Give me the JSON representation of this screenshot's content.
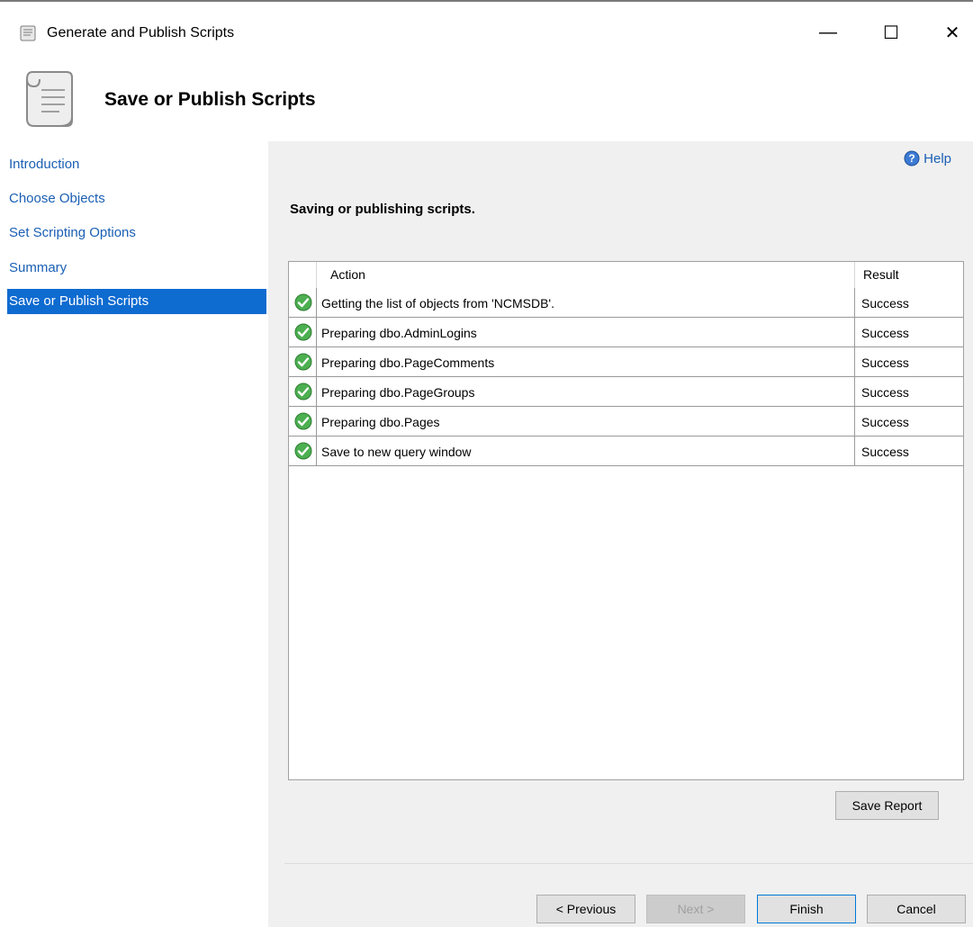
{
  "window": {
    "title": "Generate and Publish Scripts",
    "controls": {
      "minimize": "—",
      "maximize": "☐",
      "close": "✕"
    }
  },
  "header": {
    "title": "Save or Publish Scripts",
    "icon": "script-scroll-icon"
  },
  "sidebar": {
    "items": [
      {
        "label": "Introduction",
        "active": false
      },
      {
        "label": "Choose Objects",
        "active": false
      },
      {
        "label": "Set Scripting Options",
        "active": false
      },
      {
        "label": "Summary",
        "active": false
      },
      {
        "label": "Save or Publish Scripts",
        "active": true
      }
    ]
  },
  "main": {
    "help_label": "Help",
    "status_heading": "Saving or publishing scripts.",
    "grid": {
      "columns": [
        "Action",
        "Result"
      ],
      "rows": [
        {
          "action": "Getting the list of objects from 'NCMSDB'.",
          "result": "Success",
          "status_icon": "success-check-icon"
        },
        {
          "action": "Preparing dbo.AdminLogins",
          "result": "Success",
          "status_icon": "success-check-icon"
        },
        {
          "action": "Preparing dbo.PageComments",
          "result": "Success",
          "status_icon": "success-check-icon"
        },
        {
          "action": "Preparing dbo.PageGroups",
          "result": "Success",
          "status_icon": "success-check-icon"
        },
        {
          "action": "Preparing dbo.Pages",
          "result": "Success",
          "status_icon": "success-check-icon"
        },
        {
          "action": "Save to new query window",
          "result": "Success",
          "status_icon": "success-check-icon"
        }
      ]
    },
    "save_report_label": "Save Report"
  },
  "footer": {
    "previous_label": "< Previous",
    "next_label": "Next >",
    "finish_label": "Finish",
    "cancel_label": "Cancel"
  },
  "colors": {
    "accent": "#0e6bd0",
    "link": "#1a5fb4",
    "success": "#4caf50"
  }
}
